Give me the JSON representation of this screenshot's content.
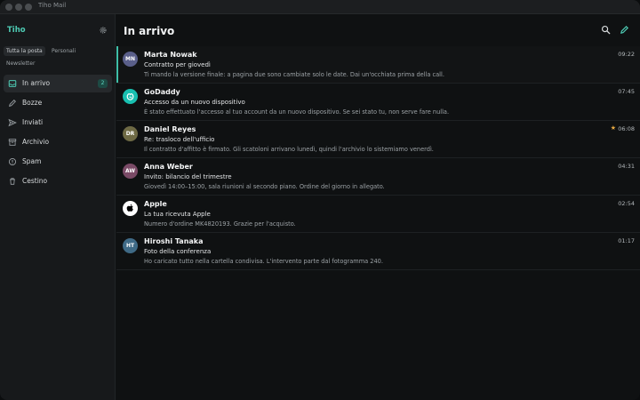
{
  "window": {
    "title": "Tiho Mail"
  },
  "sidebar": {
    "account": "Tiho",
    "filters": [
      "Tutta la posta",
      "Personali",
      "Newsletter"
    ],
    "folders": [
      {
        "label": "In arrivo",
        "icon": "inbox-icon",
        "badge": "2",
        "active": true
      },
      {
        "label": "Bozze",
        "icon": "pencil-icon"
      },
      {
        "label": "Inviati",
        "icon": "send-icon"
      },
      {
        "label": "Archivio",
        "icon": "archive-icon"
      },
      {
        "label": "Spam",
        "icon": "alert-icon"
      },
      {
        "label": "Cestino",
        "icon": "trash-icon"
      }
    ]
  },
  "main": {
    "title": "In arrivo",
    "messages": [
      {
        "initials": "MN",
        "avatar_color": "#5a5f8a",
        "sender": "Marta Nowak",
        "subject": "Contratto per giovedì",
        "preview": "Ti mando la versione finale: a pagina due sono cambiate solo le date. Dai un'occhiata prima della call.",
        "time": "09:22",
        "active": true
      },
      {
        "initials": "",
        "avatar_color": "#18bfb0",
        "avatar_icon": "godaddy-logo-icon",
        "sender": "GoDaddy",
        "subject": "Accesso da un nuovo dispositivo",
        "preview": "È stato effettuato l'accesso al tuo account da un nuovo dispositivo. Se sei stato tu, non serve fare nulla.",
        "time": "07:45"
      },
      {
        "initials": "DR",
        "avatar_color": "#6e6a45",
        "sender": "Daniel Reyes",
        "subject": "Re: trasloco dell'ufficio",
        "preview": "Il contratto d'affitto è firmato. Gli scatoloni arrivano lunedì, quindi l'archivio lo sistemiamo venerdì.",
        "time": "06:08",
        "starred": true
      },
      {
        "initials": "AW",
        "avatar_color": "#7a4a66",
        "sender": "Anna Weber",
        "subject": "Invito: bilancio del trimestre",
        "preview": "Giovedì 14:00–15:00, sala riunioni al secondo piano. Ordine del giorno in allegato.",
        "time": "04:31"
      },
      {
        "initials": "",
        "avatar_color": "#ffffff",
        "avatar_icon": "apple-logo-icon",
        "sender": "Apple",
        "subject": "La tua ricevuta Apple",
        "preview": "Numero d'ordine MK4820193. Grazie per l'acquisto.",
        "time": "02:54"
      },
      {
        "initials": "HT",
        "avatar_color": "#3f6a86",
        "sender": "Hiroshi Tanaka",
        "subject": "Foto della conferenza",
        "preview": "Ho caricato tutto nella cartella condivisa. L'intervento parte dal fotogramma 240.",
        "time": "01:17"
      }
    ]
  },
  "colors": {
    "accent": "#4ecbb4",
    "badge_bg": "#1d4a44",
    "star": "#e7a942"
  }
}
